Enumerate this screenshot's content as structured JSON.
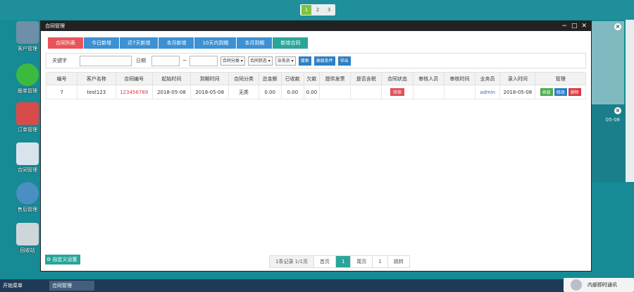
{
  "desktop": {
    "pager": [
      "1",
      "2",
      "3"
    ],
    "icons": [
      {
        "label": "客户管理",
        "color": "#6d8fa8"
      },
      {
        "label": "跟单管理",
        "color": "#3cba3f"
      },
      {
        "label": "订单管理",
        "color": "#d94b4b"
      },
      {
        "label": "合同管理",
        "color": "#d8e3ee"
      },
      {
        "label": "售后管理",
        "color": "#4a8fc2"
      },
      {
        "label": "回收站",
        "color": "#cfd6da"
      }
    ],
    "bg_date": "05-08"
  },
  "window": {
    "title": "合同管理",
    "tabs": [
      "合同列表",
      "今日新增",
      "近7天新增",
      "本月新增",
      "10天内到期",
      "本月到期",
      "新增合同"
    ],
    "search": {
      "keyword_label": "关键字",
      "date_label": "日期",
      "range_sep": "~",
      "select_type": "合同分类",
      "select_status": "合同状态",
      "select_staff": "业务员",
      "search_button": "搜索",
      "advanced_button": "高级条件",
      "export_button": "导出"
    },
    "table": {
      "headers": [
        "编号",
        "客户名称",
        "合同编号",
        "起始时间",
        "到期时间",
        "合同分类",
        "总金额",
        "已收款",
        "欠款",
        "提供发票",
        "是否含税",
        "合同状态",
        "审核人员",
        "审核时间",
        "业务员",
        "录入时间",
        "管理"
      ],
      "rows": [
        {
          "id": "7",
          "customer": "test123",
          "contract_no": "123456789",
          "start": "2018-05-08",
          "end": "2018-05-08",
          "category": "无类",
          "total": "0.00",
          "received": "0.00",
          "owed": "0.00",
          "invoice": "",
          "tax": "",
          "status": "待审",
          "reviewer": "",
          "review_time": "",
          "salesman": "admin",
          "entry_time": "2018-05-08",
          "actions": [
            "收款",
            "修改",
            "删除"
          ]
        }
      ]
    },
    "custom_settings": "自定义设置",
    "pagination": {
      "info": "1条记录 1/1页",
      "first": "首页",
      "current": "1",
      "last": "尾页",
      "jump_value": "1",
      "jump": "跳转"
    }
  },
  "taskbar": {
    "start": "开始菜单",
    "task": "合同管理",
    "chat": "内部即时通讯"
  }
}
